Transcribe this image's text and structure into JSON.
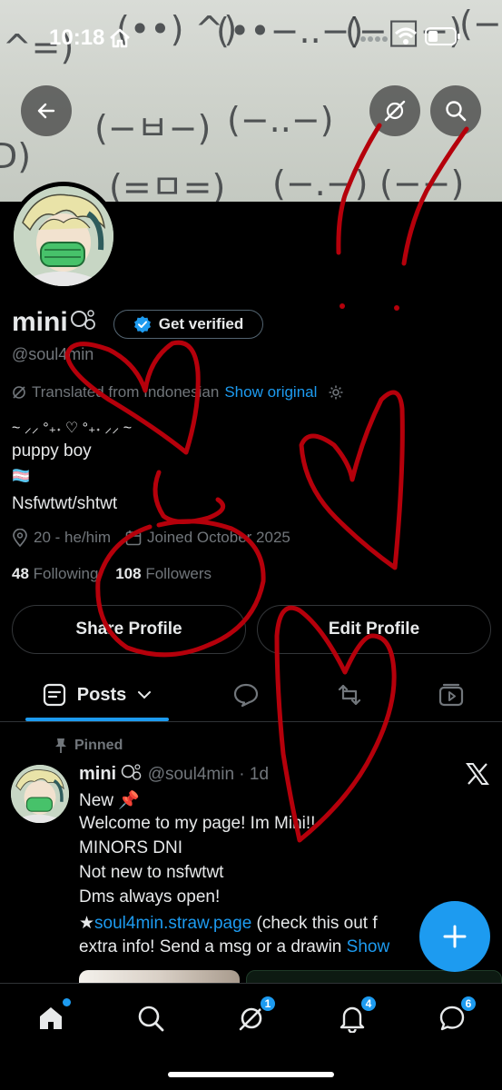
{
  "status_bar": {
    "time": "10:18"
  },
  "profile": {
    "display_name": "mini",
    "verify_label": "Get verified",
    "handle": "@soul4min",
    "translated_label": "Translated from Indonesian",
    "show_original": "Show original",
    "bio": [
      "~ ⸝⸝ °₊˖ ♡ °₊˖ ⸝⸝ ~",
      "puppy boy",
      "🏳️‍⚧️",
      "Nsfwtwt/shtwt"
    ],
    "location": "20 - he/him",
    "joined": "Joined October 2025",
    "following_count": "48",
    "following_label": "Following",
    "followers_count": "108",
    "followers_label": "Followers",
    "share_label": "Share Profile",
    "edit_label": "Edit Profile"
  },
  "tabs": {
    "posts_label": "Posts"
  },
  "post": {
    "pinned_label": "Pinned",
    "author": "mini",
    "handle": "@soul4min",
    "time": "· 1d",
    "lines": [
      "New 📌",
      "Welcome to my page! Im Mini!!",
      "MINORS DNI",
      "Not new to nsfwtwt",
      "Dms always open!"
    ],
    "star": "★",
    "link": "soul4min.straw.page",
    "link_after": " (check this out f",
    "last_line": "extra info! Send a msg or a drawin",
    "show_more": "Show"
  },
  "nav": {
    "messages_badge": "1",
    "notifications_badge": "4",
    "chat_badge": "6"
  },
  "colors": {
    "accent": "#1d9bf0",
    "doodle": "#b5000b"
  },
  "icons": [
    "back-arrow-icon",
    "grok-icon",
    "search-icon",
    "verified-badge-icon",
    "translate-icon",
    "settings-icon",
    "location-icon",
    "calendar-icon",
    "posts-tab-icon",
    "replies-tab-icon",
    "reposts-tab-icon",
    "media-tab-icon",
    "pin-icon",
    "x-logo-icon",
    "compose-plus-icon",
    "home-icon",
    "explore-icon",
    "grok-nav-icon",
    "bell-icon",
    "messages-icon"
  ]
}
